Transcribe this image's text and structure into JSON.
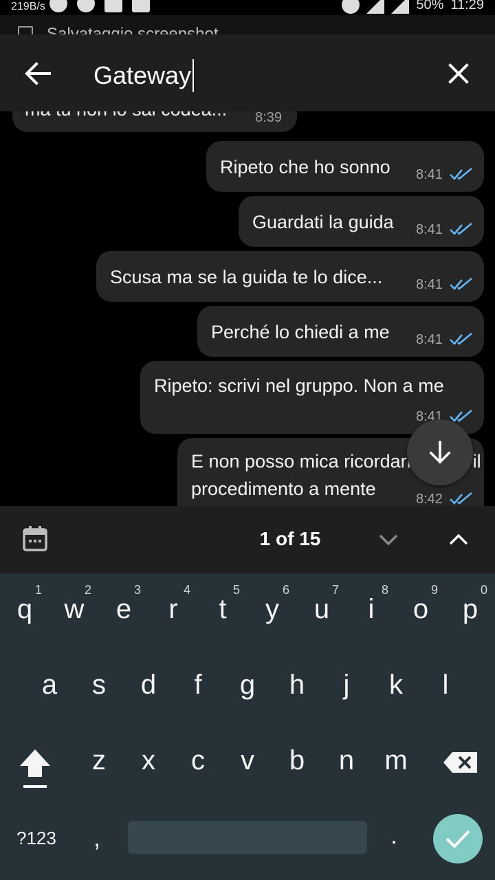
{
  "status_bar": {
    "net_speed": "219B/s",
    "battery": "50%",
    "clock": "11:29"
  },
  "notification": {
    "text": "Salvataggio screenshot"
  },
  "search": {
    "query": "Gateway",
    "back_icon": "arrow-back-icon",
    "close_icon": "close-icon"
  },
  "chat": {
    "partial_message": {
      "text": "ma tu non lo sai codea...",
      "time": "8:39"
    },
    "messages": [
      {
        "lines": [
          "Ripeto che ho sonno"
        ],
        "time": "8:41",
        "read": true
      },
      {
        "lines": [
          "Guardati la guida"
        ],
        "time": "8:41",
        "read": true
      },
      {
        "lines": [
          "Scusa ma se la guida te lo dice..."
        ],
        "time": "8:41",
        "read": true
      },
      {
        "lines": [
          "Perché lo chiedi a me"
        ],
        "time": "8:41",
        "read": true
      },
      {
        "lines": [
          "Ripeto: scrivi nel gruppo. Non a me"
        ],
        "time": "8:41",
        "read": true
      },
      {
        "lines": [
          "E non posso mica ricordarmi tutto il",
          "procedimento a mente"
        ],
        "time": "8:42",
        "read": true
      }
    ],
    "ticks_color": "#64b5f6"
  },
  "search_nav": {
    "counter": "1 of 15"
  },
  "keyboard": {
    "row1": [
      {
        "ch": "q",
        "num": "1"
      },
      {
        "ch": "w",
        "num": "2"
      },
      {
        "ch": "e",
        "num": "3"
      },
      {
        "ch": "r",
        "num": "4"
      },
      {
        "ch": "t",
        "num": "5"
      },
      {
        "ch": "y",
        "num": "6"
      },
      {
        "ch": "u",
        "num": "7"
      },
      {
        "ch": "i",
        "num": "8"
      },
      {
        "ch": "o",
        "num": "9"
      },
      {
        "ch": "p",
        "num": "0"
      }
    ],
    "row2": [
      "a",
      "s",
      "d",
      "f",
      "g",
      "h",
      "j",
      "k",
      "l"
    ],
    "row3": [
      "z",
      "x",
      "c",
      "v",
      "b",
      "n",
      "m"
    ],
    "mode_label": "?123",
    "comma": ",",
    "period": ".",
    "accent_color": "#80cbc4"
  }
}
